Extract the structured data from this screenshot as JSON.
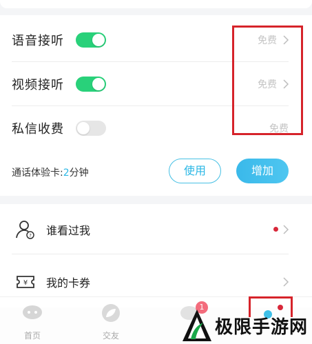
{
  "settings": {
    "rows": [
      {
        "label": "语音接听",
        "enabled": true,
        "price": "免费"
      },
      {
        "label": "视频接听",
        "enabled": true,
        "price": "免费"
      },
      {
        "label": "私信收费",
        "enabled": false,
        "price": "免费"
      }
    ],
    "call_card": {
      "prefix": "通话体验卡:",
      "value": "2",
      "unit": "分钟"
    },
    "use_button": "使用",
    "add_button": "增加"
  },
  "menu": {
    "items": [
      {
        "label": "谁看过我",
        "icon": "visitor-icon",
        "has_dot": true
      },
      {
        "label": "我的卡券",
        "icon": "coupon-icon",
        "has_dot": false
      }
    ]
  },
  "tabbar": {
    "tabs": [
      {
        "label": "首页",
        "icon": "home-chat-icon"
      },
      {
        "label": "交友",
        "icon": "leaf-icon"
      },
      {
        "label": "",
        "icon": "message-icon",
        "badge": "1"
      },
      {
        "label": "",
        "icon": "profile-icon",
        "has_dot": true
      }
    ]
  },
  "watermark": {
    "text": "极限手游网"
  },
  "colors": {
    "toggle_on": "#29d17a",
    "accent": "#2ab7e5",
    "highlight": "#d6232a"
  }
}
